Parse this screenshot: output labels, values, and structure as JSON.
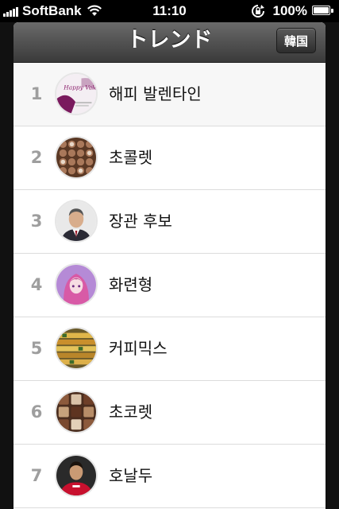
{
  "status_bar": {
    "carrier": "SoftBank",
    "time": "11:10",
    "battery": "100%",
    "icons": [
      "signal-icon",
      "wifi-icon",
      "rotation-lock-icon",
      "battery-icon"
    ]
  },
  "navbar": {
    "title": "トレンド",
    "country_button": "韓国"
  },
  "trends": [
    {
      "rank": "1",
      "label": "해피 발렌타인",
      "thumb": "valentine-card",
      "thumb_text": "Happy Valentine"
    },
    {
      "rank": "2",
      "label": "초콜렛",
      "thumb": "chocolate-box"
    },
    {
      "rank": "3",
      "label": "장관 후보",
      "thumb": "man-portrait"
    },
    {
      "rank": "4",
      "label": "화련형",
      "thumb": "anime-girl"
    },
    {
      "rank": "5",
      "label": "커피믹스",
      "thumb": "coffee-sticks"
    },
    {
      "rank": "6",
      "label": "초코렛",
      "thumb": "chocolate-assortment"
    },
    {
      "rank": "7",
      "label": "호날두",
      "thumb": "footballer-portrait"
    }
  ],
  "colors": {
    "navbar": "#4a4a4a",
    "rank_text": "#9e9e9e",
    "divider": "#dcdcdc"
  }
}
